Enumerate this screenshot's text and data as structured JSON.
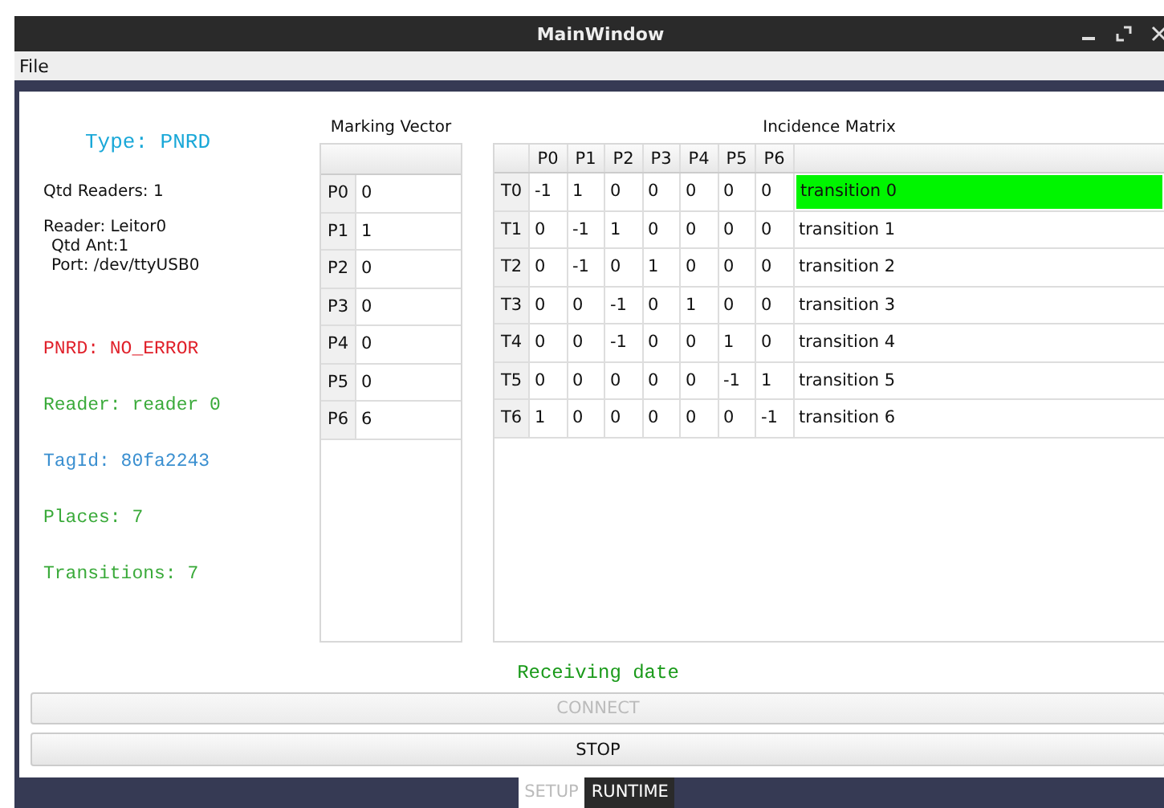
{
  "window": {
    "title": "MainWindow"
  },
  "menu": [
    "File"
  ],
  "info": {
    "type": "Type: PNRD",
    "readers": "Qtd Readers: 1",
    "reader_lines": [
      "Reader: Leitor0",
      "Qtd Ant:1",
      "Port: /dev/ttyUSB0"
    ]
  },
  "status_lines": [
    {
      "text": "PNRD: NO_ERROR",
      "color": "#e0202a"
    },
    {
      "text": "Reader: reader 0",
      "color": "#3aaa3a"
    },
    {
      "text": "TagId: 80fa2243",
      "color": "#3a8fd0"
    },
    {
      "text": "Places: 7",
      "color": "#3aaa3a"
    },
    {
      "text": "Transitions: 7",
      "color": "#3aaa3a"
    }
  ],
  "marking_vector": {
    "title": "Marking Vector",
    "rows": [
      {
        "place": "P0",
        "value": "0"
      },
      {
        "place": "P1",
        "value": "1"
      },
      {
        "place": "P2",
        "value": "0"
      },
      {
        "place": "P3",
        "value": "0"
      },
      {
        "place": "P4",
        "value": "0"
      },
      {
        "place": "P5",
        "value": "0"
      },
      {
        "place": "P6",
        "value": "6"
      }
    ]
  },
  "incidence_matrix": {
    "title": "Incidence Matrix",
    "columns": [
      "P0",
      "P1",
      "P2",
      "P3",
      "P4",
      "P5",
      "P6"
    ],
    "rows": [
      {
        "label": "T0",
        "values": [
          "-1",
          "1",
          "0",
          "0",
          "0",
          "0",
          "0"
        ],
        "transition": "transition 0",
        "selected": true
      },
      {
        "label": "T1",
        "values": [
          "0",
          "-1",
          "1",
          "0",
          "0",
          "0",
          "0"
        ],
        "transition": "transition 1",
        "selected": false
      },
      {
        "label": "T2",
        "values": [
          "0",
          "-1",
          "0",
          "1",
          "0",
          "0",
          "0"
        ],
        "transition": "transition 2",
        "selected": false
      },
      {
        "label": "T3",
        "values": [
          "0",
          "0",
          "-1",
          "0",
          "1",
          "0",
          "0"
        ],
        "transition": "transition 3",
        "selected": false
      },
      {
        "label": "T4",
        "values": [
          "0",
          "0",
          "-1",
          "0",
          "0",
          "1",
          "0"
        ],
        "transition": "transition 4",
        "selected": false
      },
      {
        "label": "T5",
        "values": [
          "0",
          "0",
          "0",
          "0",
          "0",
          "-1",
          "1"
        ],
        "transition": "transition 5",
        "selected": false
      },
      {
        "label": "T6",
        "values": [
          "1",
          "0",
          "0",
          "0",
          "0",
          "0",
          "-1"
        ],
        "transition": "transition 6",
        "selected": false
      }
    ]
  },
  "status_message": "Receiving date",
  "buttons": [
    {
      "label": "CONNECT",
      "disabled": true
    },
    {
      "label": "STOP",
      "disabled": false
    }
  ],
  "tabs": [
    {
      "label": "SETUP",
      "selected": false
    },
    {
      "label": "RUNTIME",
      "selected": true
    }
  ]
}
